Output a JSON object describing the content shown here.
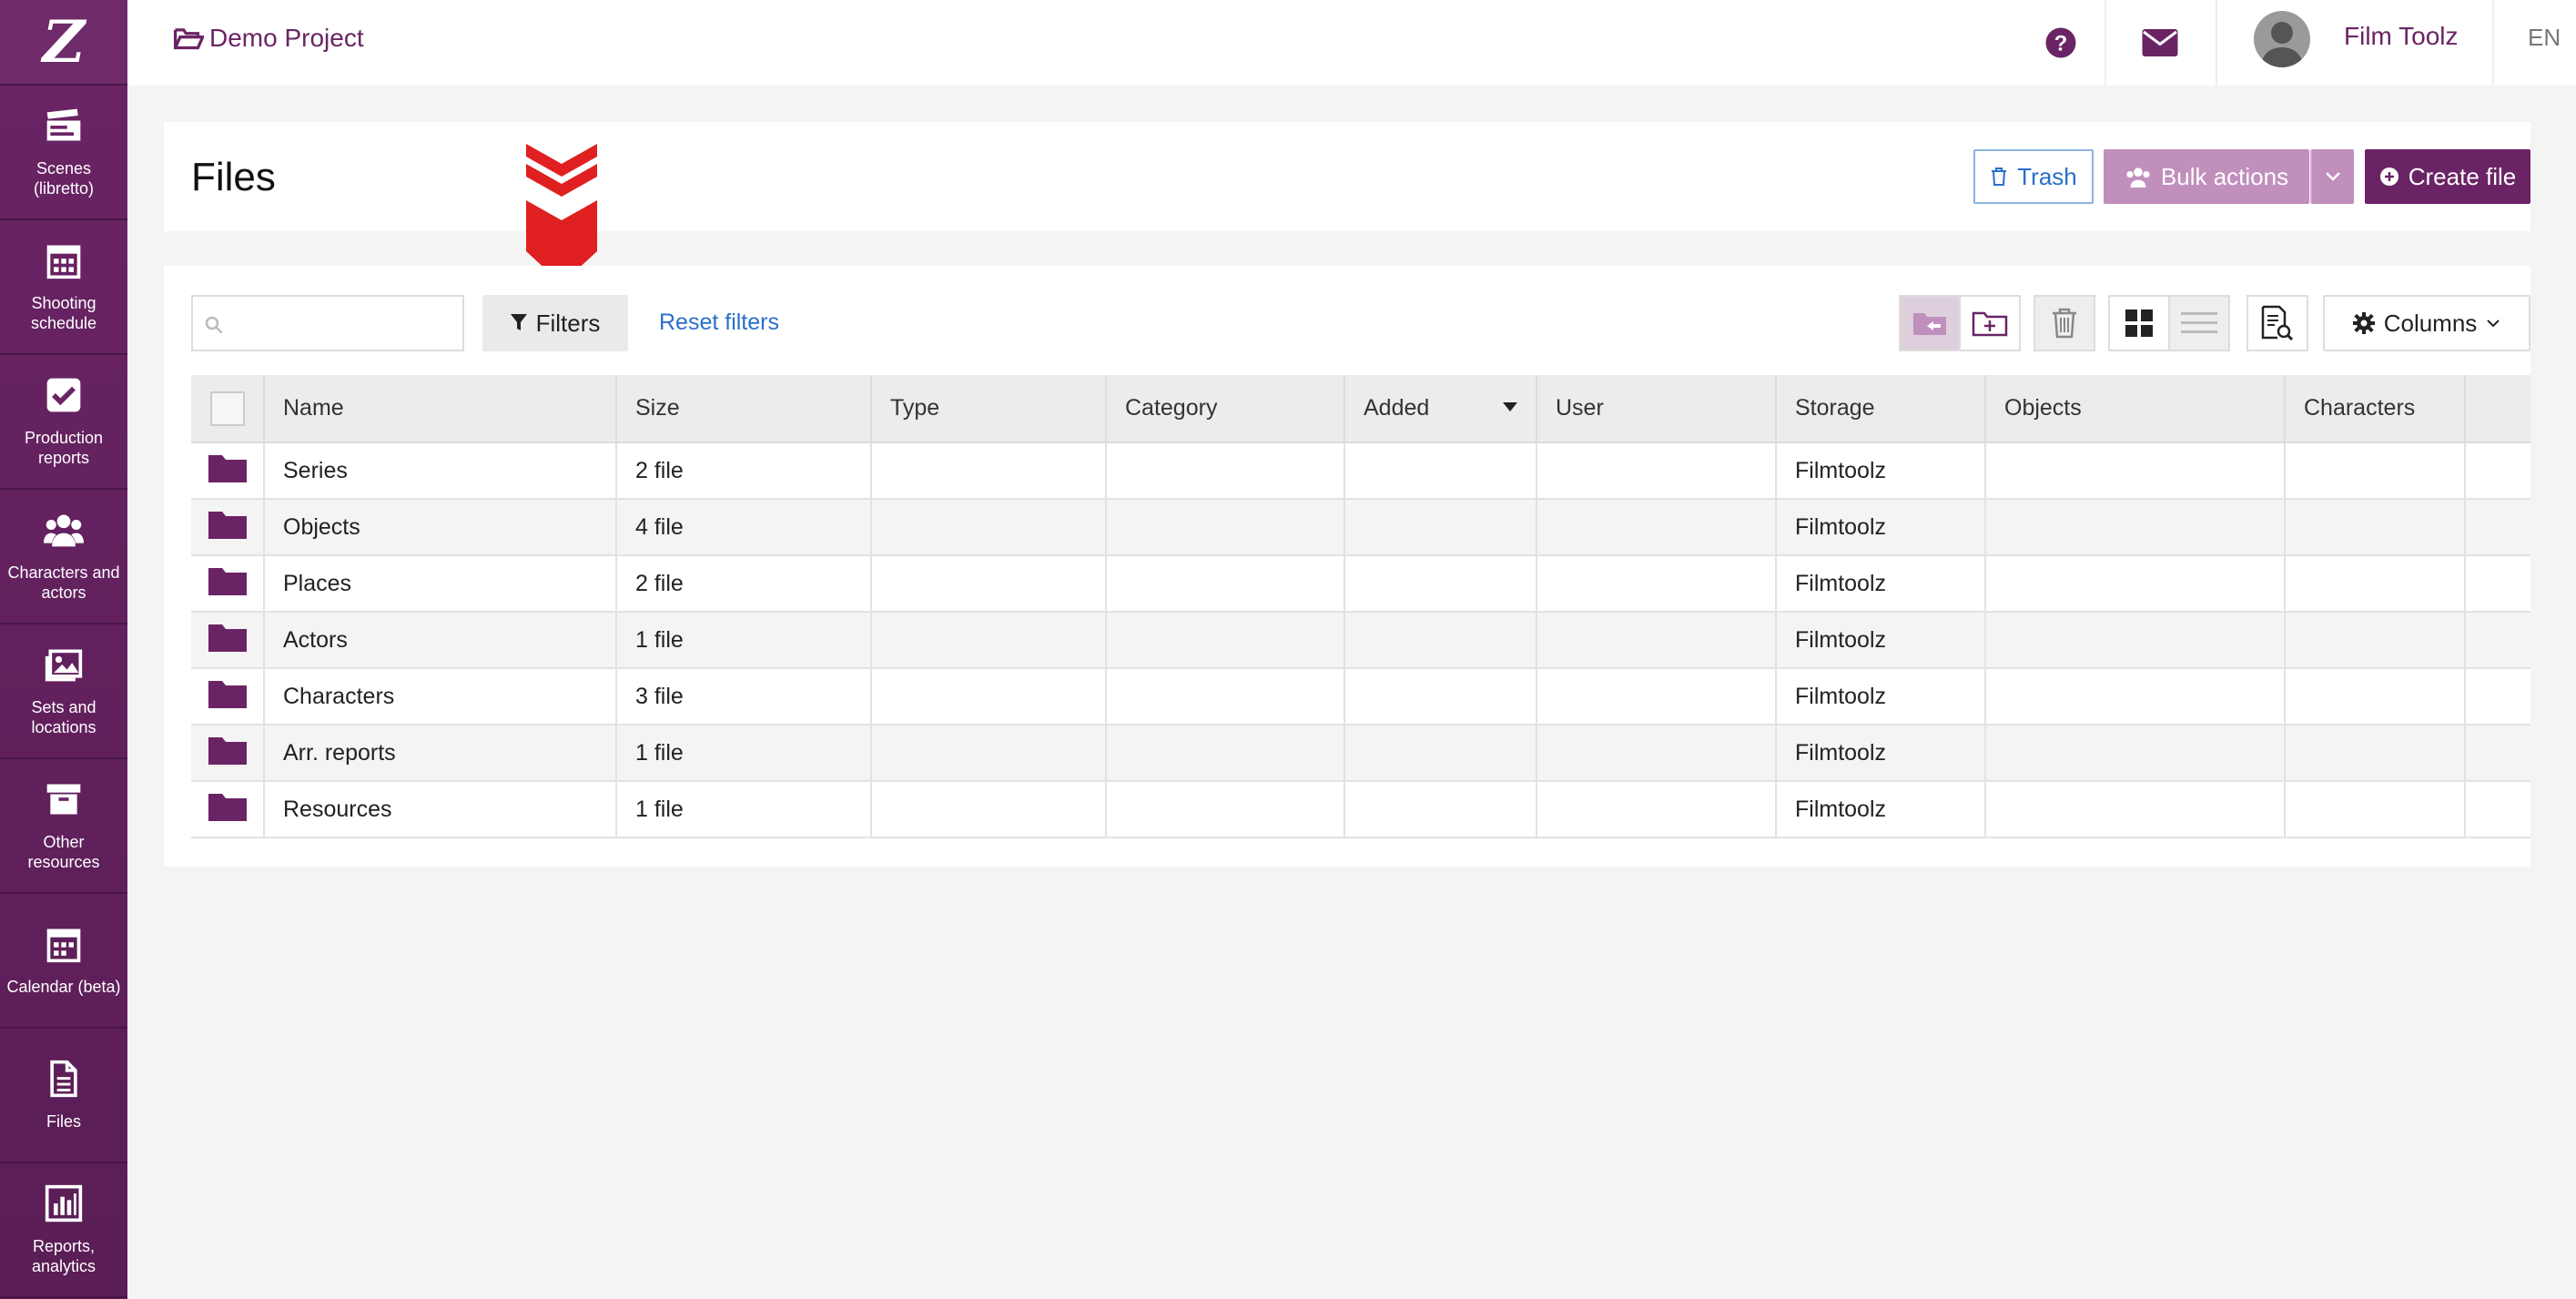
{
  "sidebar": {
    "logo": "Z",
    "items": [
      {
        "label": "Scenes (libretto)",
        "icon": "clapperboard-icon"
      },
      {
        "label": "Shooting schedule",
        "icon": "calendar-grid-icon"
      },
      {
        "label": "Production reports",
        "icon": "checkbox-icon"
      },
      {
        "label": "Characters and actors",
        "icon": "users-icon"
      },
      {
        "label": "Sets and locations",
        "icon": "image-icon"
      },
      {
        "label": "Other resources",
        "icon": "archive-box-icon"
      },
      {
        "label": "Calendar (beta)",
        "icon": "calendar-icon"
      },
      {
        "label": "Files",
        "icon": "file-icon"
      },
      {
        "label": "Reports, analytics",
        "icon": "bar-chart-icon"
      }
    ]
  },
  "topbar": {
    "project": "Demo Project",
    "user_name": "Film Toolz",
    "language": "EN"
  },
  "header": {
    "title": "Files",
    "trash_label": "Trash",
    "bulk_label": "Bulk actions",
    "create_label": "Create file"
  },
  "toolbar": {
    "search_placeholder": "",
    "filters_label": "Filters",
    "reset_label": "Reset filters",
    "columns_label": "Columns"
  },
  "table": {
    "columns": [
      "Name",
      "Size",
      "Type",
      "Category",
      "Added",
      "User",
      "Storage",
      "Objects",
      "Characters"
    ],
    "rows": [
      {
        "name": "Series",
        "size": "2 file",
        "storage": "Filmtoolz"
      },
      {
        "name": "Objects",
        "size": "4 file",
        "storage": "Filmtoolz"
      },
      {
        "name": "Places",
        "size": "2 file",
        "storage": "Filmtoolz"
      },
      {
        "name": "Actors",
        "size": "1 file",
        "storage": "Filmtoolz"
      },
      {
        "name": "Characters",
        "size": "3 file",
        "storage": "Filmtoolz"
      },
      {
        "name": "Arr. reports",
        "size": "1 file",
        "storage": "Filmtoolz"
      },
      {
        "name": "Resources",
        "size": "1 file",
        "storage": "Filmtoolz"
      }
    ]
  },
  "colors": {
    "brand": "#6a2465",
    "brand_light": "#c08fbc",
    "link": "#2a6fc9",
    "arrow": "#e02020"
  }
}
